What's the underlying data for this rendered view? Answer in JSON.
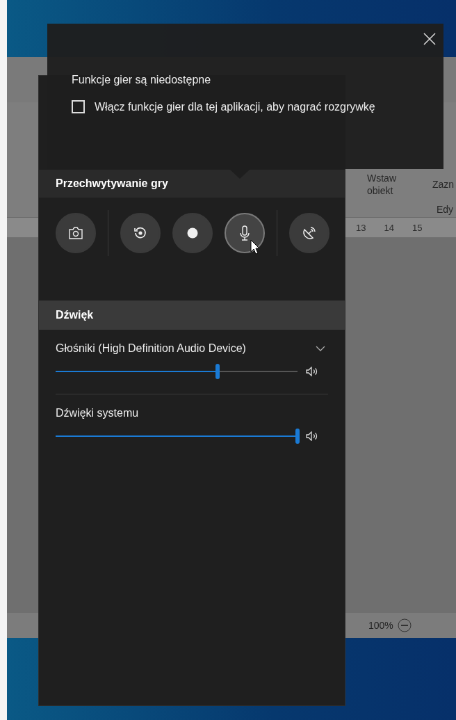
{
  "wordpad": {
    "ribbon_labels": [
      {
        "text": "Wstaw obiekt"
      },
      {
        "text": "Zazn"
      },
      {
        "text": "Edy"
      }
    ],
    "ruler_numbers": [
      "13",
      "14",
      "15"
    ],
    "zoom": "100%"
  },
  "game_bar": {
    "notice": {
      "title": "Funkcje gier są niedostępne",
      "checkbox": {
        "label": "Włącz funkcje gier dla tej aplikacji, aby nagrać rozgrywkę",
        "checked": false
      }
    },
    "capture": {
      "title": "Przechwytywanie gry",
      "button_groups": [
        {
          "buttons": [
            {
              "kind": "screenshot",
              "hovered": false
            }
          ]
        },
        {
          "buttons": [
            {
              "kind": "record-last",
              "hovered": false
            },
            {
              "kind": "record",
              "hovered": false
            },
            {
              "kind": "microphone",
              "hovered": true
            }
          ]
        },
        {
          "buttons": [
            {
              "kind": "broadcast",
              "hovered": false
            }
          ]
        }
      ]
    },
    "audio": {
      "title": "Dźwięk",
      "channels": [
        {
          "name": "Głośniki (High Definition Audio Device)",
          "expandable": true,
          "level": 0.67
        },
        {
          "name": "Dźwięki systemu",
          "expandable": false,
          "level": 1
        }
      ]
    }
  }
}
